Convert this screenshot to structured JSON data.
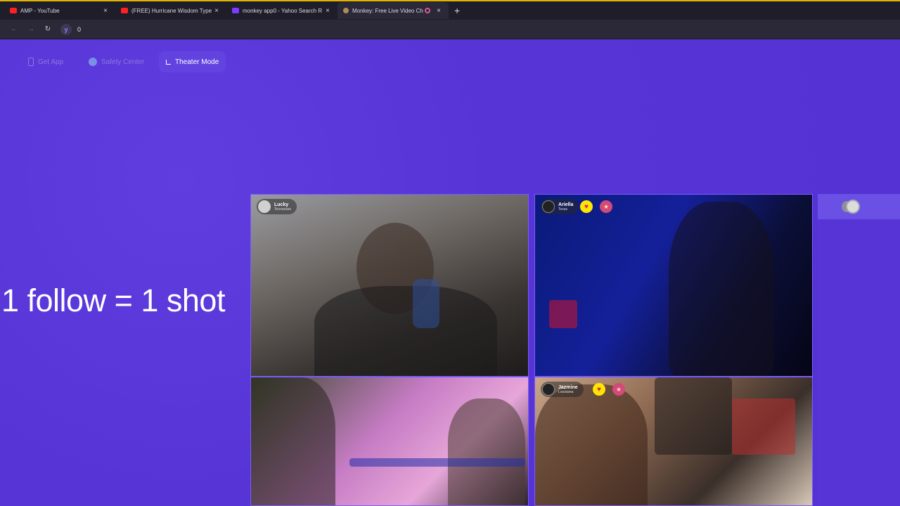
{
  "browser": {
    "tabs": [
      {
        "title": "AMP - YouTube",
        "icon": "youtube-icon",
        "active": false
      },
      {
        "title": "(FREE) Hurricane Wisdom Type",
        "icon": "youtube-icon",
        "active": false
      },
      {
        "title": "monkey app0 - Yahoo Search R",
        "icon": "yahoo-icon",
        "active": false
      },
      {
        "title": "Monkey: Free Live Video Ch",
        "icon": "monkey-icon",
        "active": true
      }
    ],
    "close_glyph": "×",
    "new_tab_glyph": "+",
    "address": "0",
    "yahoo_letter": "y"
  },
  "toolbar": {
    "get_app": "Get App",
    "safety_center": "Safety Center",
    "theater_mode": "Theater Mode"
  },
  "overlay_text": "1 follow = 1 shot",
  "videos": [
    {
      "name": "Lucky",
      "location": "Tennessee"
    },
    {
      "name": "Ariella",
      "location": "Texas"
    },
    {
      "name": "Jazmine",
      "location": "Louisiana"
    }
  ],
  "colors": {
    "page_bg": "#5a34d8",
    "accent": "#7a5cff",
    "heart": "#ffe600"
  }
}
